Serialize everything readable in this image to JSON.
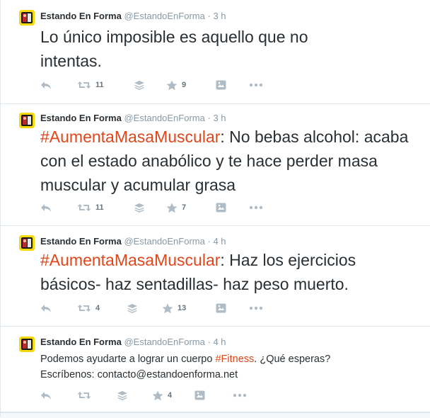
{
  "colors": {
    "hashtag": "#e0461a",
    "muted": "#8899a6",
    "text": "#292f33",
    "icon": "#b0bcc5"
  },
  "tweets": [
    {
      "name": "Estando En Forma",
      "handle": "@EstandoEnForma",
      "dot": "·",
      "time": "3 h",
      "hashtag": "",
      "text": "Lo único imposible es aquello que no intentas.",
      "retweets": "11",
      "favorites": "9"
    },
    {
      "name": "Estando En Forma",
      "handle": "@EstandoEnForma",
      "dot": "·",
      "time": "3 h",
      "hashtag": "#AumentaMasaMuscular",
      "text": ": No bebas alcohol: acaba con el estado anabólico y te hace perder masa muscular y acumular grasa",
      "retweets": "11",
      "favorites": "7"
    },
    {
      "name": "Estando En Forma",
      "handle": "@EstandoEnForma",
      "dot": "·",
      "time": "4 h",
      "hashtag": "#AumentaMasaMuscular",
      "text": ": Haz los ejercicios básicos- haz sentadillas- haz peso muerto.",
      "retweets": "4",
      "favorites": "13"
    },
    {
      "name": "Estando En Forma",
      "handle": "@EstandoEnForma",
      "dot": "·",
      "time": "4 h",
      "text_before": "Podemos ayudarte a lograr un cuerpo ",
      "hashtag": "#Fitness",
      "text_after": ". ¿Qué esperas?",
      "line2": "Escríbenos: contacto@estandoenforma.net",
      "retweets": "",
      "favorites": "4"
    }
  ],
  "icons": [
    "reply-icon",
    "retweet-icon",
    "buffer-icon",
    "favorite-icon",
    "preview-icon",
    "more-icon"
  ]
}
